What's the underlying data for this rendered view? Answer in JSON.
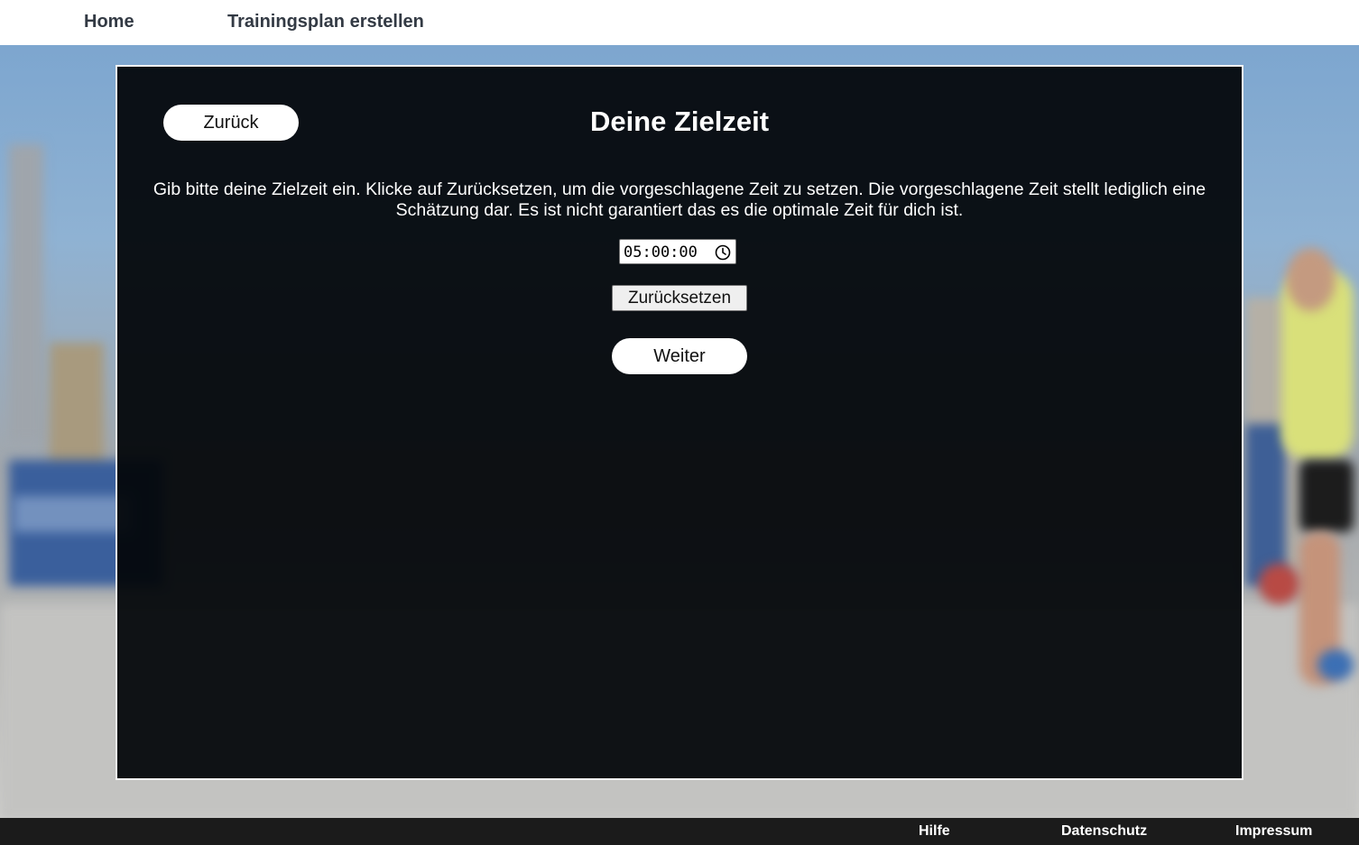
{
  "nav": {
    "home": "Home",
    "create_plan": "Trainingsplan erstellen"
  },
  "panel": {
    "back_label": "Zurück",
    "title": "Deine Zielzeit",
    "description": "Gib bitte deine Zielzeit ein. Klicke auf Zurücksetzen, um die vorgeschlagene Zeit zu setzen. Die vorgeschlagene Zeit stellt lediglich eine Schätzung dar. Es ist nicht garantiert das es die optimale Zeit für dich ist.",
    "time_value": "05:00:00",
    "reset_label": "Zurücksetzen",
    "next_label": "Weiter"
  },
  "footer": {
    "help": "Hilfe",
    "privacy": "Datenschutz",
    "imprint": "Impressum"
  },
  "colors": {
    "panel_bg": "#03060a",
    "footer_bg": "#1b1b1b",
    "nav_text": "#333a44"
  },
  "icons": {
    "time_picker": "clock-icon"
  }
}
